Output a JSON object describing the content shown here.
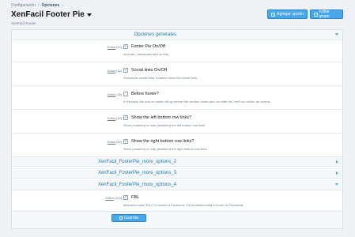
{
  "breadcrumb": {
    "items": [
      "Configuración",
      "Opciones"
    ]
  },
  "page": {
    "title": "XenFacil Footer Pie",
    "subtitle": "XenFacil Footer"
  },
  "toolbar": {
    "add_option_label": "Agregar opción",
    "edit_group_label": "Editar grupo"
  },
  "groups": [
    {
      "label": "Opciones generales",
      "expanded": true
    },
    {
      "label": "XenFacil_FooterPie_more_options_2",
      "expanded": false
    },
    {
      "label": "XenFacil_FooterPie_more_options_3",
      "expanded": false
    },
    {
      "label": "XenFacil_FooterPie_more_options_4",
      "expanded": true
    }
  ],
  "options": [
    {
      "edit": "Editar",
      "order": "[10]",
      "label": "Footer Pie On/Off",
      "checked": true,
      "desc": "Activate / deactivate add on fully"
    },
    {
      "edit": "Editar",
      "order": "[20]",
      "label": "Social links On/Off",
      "checked": true,
      "desc": "Show/hide social links; enabled show the social links"
    },
    {
      "edit": "Editar",
      "order": "[30]",
      "label": "Before footer?",
      "checked": false,
      "desc": "If checked, the add on footer will go before the xenforo footer and not after the XenForo footer, as normal."
    },
    {
      "edit": "Editar",
      "order": "[40]",
      "label": "Show the left bottom row links?",
      "checked": true,
      "desc": "Show (enabled) or hide (disabled) the left bottom row links."
    },
    {
      "edit": "Editar",
      "order": "[50]",
      "label": "Show the right bottom row links?",
      "checked": true,
      "desc": "Show (enabled) or hide (disabled) the right bottom row links."
    },
    {
      "edit": "Editar",
      "order": "[100]",
      "label": "FBL",
      "checked": true,
      "desc": "Muestra/oculta SOLO el enlace a Facebook. No muestra/oculta el icono de Facebook."
    }
  ],
  "save_label": "Guardar",
  "colors": {
    "accent": "#47a7eb",
    "link": "#2577b1",
    "muted": "#6a7d90"
  }
}
